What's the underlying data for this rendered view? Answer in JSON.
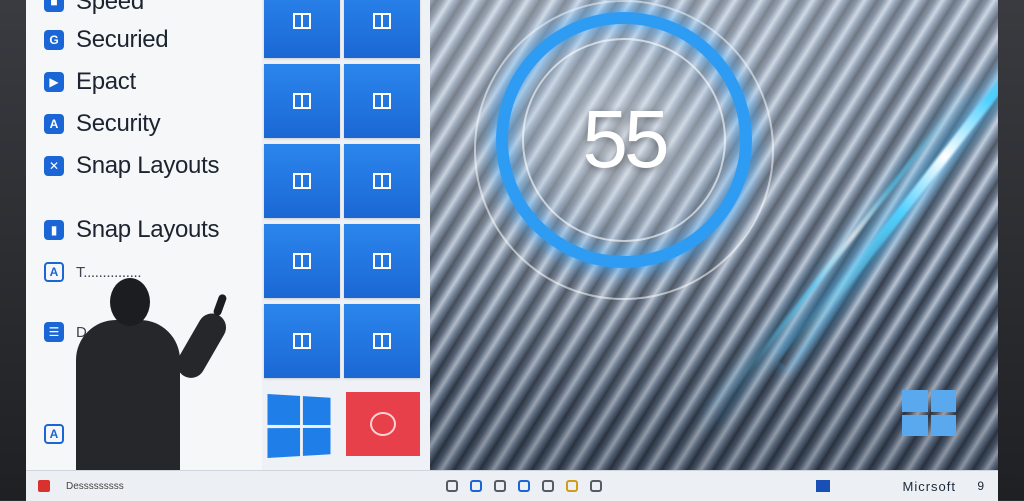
{
  "features": [
    {
      "label": "Speed",
      "icon": "square-icon"
    },
    {
      "label": "Securied",
      "icon": "shield-icon"
    },
    {
      "label": "Epact",
      "icon": "play-icon"
    },
    {
      "label": "Security",
      "icon": "lock-icon"
    },
    {
      "label": "Snap Layouts",
      "icon": "snap-icon"
    },
    {
      "label": "Snap Layouts",
      "icon": "layout-icon"
    },
    {
      "label": "T...............",
      "icon": "alert-icon"
    },
    {
      "label": "D.........",
      "icon": "settings-icon"
    },
    {
      "label": "A",
      "icon": "widget-icon"
    }
  ],
  "speed_display": {
    "value": "55"
  },
  "taskbar": {
    "app_label": "Desssssssss",
    "brand": "Micrsoft",
    "page_number": "9"
  },
  "colors": {
    "accent": "#1a66d6",
    "tile_blue": "#2b86ec",
    "ring_glow": "#2f9cf4",
    "red_tile": "#e8404a"
  }
}
